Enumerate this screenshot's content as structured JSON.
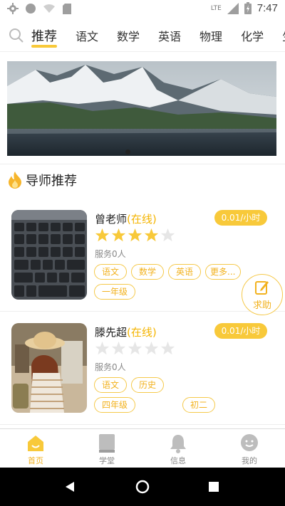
{
  "status_bar": {
    "time": "7:47",
    "network": "LTE"
  },
  "tabs": [
    {
      "label": "推荐",
      "active": true
    },
    {
      "label": "语文"
    },
    {
      "label": "数学"
    },
    {
      "label": "英语"
    },
    {
      "label": "物理"
    },
    {
      "label": "化学"
    },
    {
      "label": "生物"
    }
  ],
  "section": {
    "title": "导师推荐"
  },
  "tutors": [
    {
      "name": "曾老师",
      "status": "(在线)",
      "price": "0.01/小时",
      "rating": 4,
      "served": "服务0人",
      "tags": [
        "语文",
        "数学",
        "英语",
        "更多...",
        "一年级"
      ]
    },
    {
      "name": "滕先超",
      "status": "(在线)",
      "price": "0.01/小时",
      "rating": 0,
      "served": "服务0人",
      "tags": [
        "语文",
        "历史",
        "四年级",
        "初二"
      ]
    }
  ],
  "fab": {
    "label": "求助"
  },
  "bottom_nav": [
    {
      "label": "首页",
      "active": true
    },
    {
      "label": "学堂"
    },
    {
      "label": "信息"
    },
    {
      "label": "我的"
    }
  ],
  "colors": {
    "accent": "#f8c93a",
    "accent_text": "#f2b21f"
  }
}
